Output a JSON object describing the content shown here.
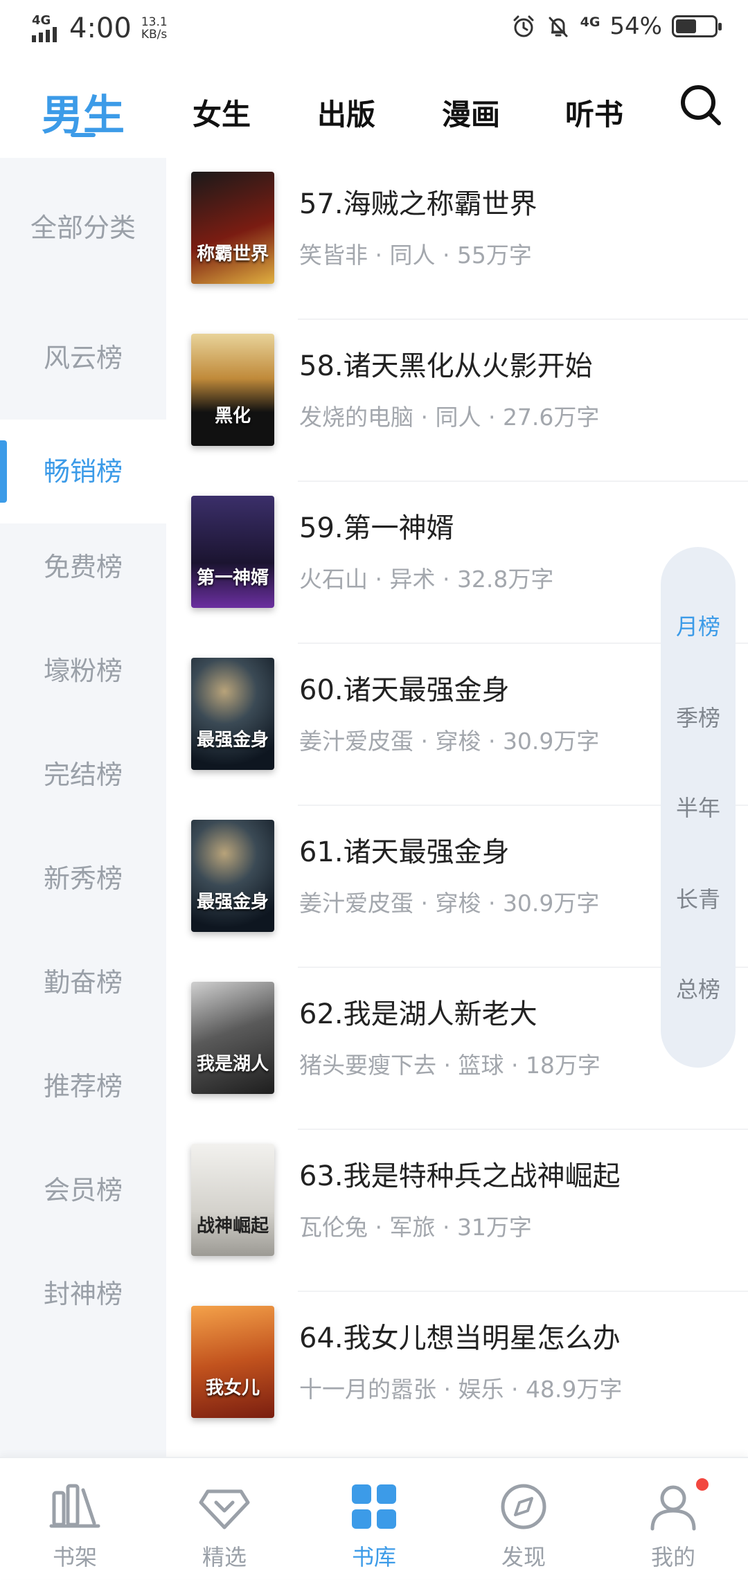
{
  "status_bar": {
    "network_left": "4G",
    "time": "4:00",
    "speed_value": "13.1",
    "speed_unit": "KB/s",
    "network_right": "4G",
    "battery_percent": "54%",
    "battery_level": 0.54,
    "icons": [
      "signal-icon",
      "alarm-icon",
      "notifications-off-icon",
      "battery-icon"
    ]
  },
  "top_tabs": [
    {
      "label": "男生",
      "active": true
    },
    {
      "label": "女生",
      "active": false
    },
    {
      "label": "出版",
      "active": false
    },
    {
      "label": "漫画",
      "active": false
    },
    {
      "label": "听书",
      "active": false
    }
  ],
  "sidebar": {
    "items": [
      {
        "label": "全部分类",
        "active": false
      },
      {
        "label": "风云榜",
        "active": false
      },
      {
        "label": "畅销榜",
        "active": true
      },
      {
        "label": "免费榜",
        "active": false
      },
      {
        "label": "壕粉榜",
        "active": false
      },
      {
        "label": "完结榜",
        "active": false
      },
      {
        "label": "新秀榜",
        "active": false
      },
      {
        "label": "勤奋榜",
        "active": false
      },
      {
        "label": "推荐榜",
        "active": false
      },
      {
        "label": "会员榜",
        "active": false
      },
      {
        "label": "封神榜",
        "active": false
      }
    ]
  },
  "books": [
    {
      "title": "57.海贼之称霸世界",
      "meta": "笑皆非 · 同人 · 55万字",
      "cover_text": "称霸世界",
      "cover_color": "#7a1c12"
    },
    {
      "title": "58.诸天黑化从火影开始",
      "meta": "发烧的电脑 · 同人 · 27.6万字",
      "cover_text": "黑化",
      "cover_color": "#3a2a1a"
    },
    {
      "title": "59.第一神婿",
      "meta": "火石山 · 异术 · 32.8万字",
      "cover_text": "第一神婿",
      "cover_color": "#2a1f44"
    },
    {
      "title": "60.诸天最强金身",
      "meta": "姜汁爱皮蛋 · 穿梭 · 30.9万字",
      "cover_text": "最强金身",
      "cover_color": "#1d2a3a"
    },
    {
      "title": "61.诸天最强金身",
      "meta": "姜汁爱皮蛋 · 穿梭 · 30.9万字",
      "cover_text": "最强金身",
      "cover_color": "#1d2a3a"
    },
    {
      "title": "62.我是湖人新老大",
      "meta": "猪头要瘦下去 · 篮球 · 18万字",
      "cover_text": "我是湖人",
      "cover_color": "#3a3a3a"
    },
    {
      "title": "63.我是特种兵之战神崛起",
      "meta": "瓦伦兔 · 军旅 · 31万字",
      "cover_text": "战神崛起",
      "cover_color": "#d8d6d2"
    },
    {
      "title": "64.我女儿想当明星怎么办",
      "meta": "十一月的嚣张 · 娱乐 · 48.9万字",
      "cover_text": "我女儿",
      "cover_color": "#c2531e"
    }
  ],
  "period_selector": [
    {
      "label": "月榜",
      "active": true
    },
    {
      "label": "季榜",
      "active": false
    },
    {
      "label": "半年",
      "active": false
    },
    {
      "label": "长青",
      "active": false
    },
    {
      "label": "总榜",
      "active": false
    }
  ],
  "bottom_nav": [
    {
      "label": "书架",
      "icon": "bookshelf-icon",
      "active": false
    },
    {
      "label": "精选",
      "icon": "diamond-icon",
      "active": false
    },
    {
      "label": "书库",
      "icon": "library-grid-icon",
      "active": true
    },
    {
      "label": "发现",
      "icon": "compass-icon",
      "active": false
    },
    {
      "label": "我的",
      "icon": "profile-icon",
      "active": false,
      "badge": true
    }
  ],
  "colors": {
    "accent": "#3c9be8",
    "sidebar_bg": "#f4f6f9",
    "muted_text": "#a3a7ad",
    "badge": "#f2473f"
  }
}
